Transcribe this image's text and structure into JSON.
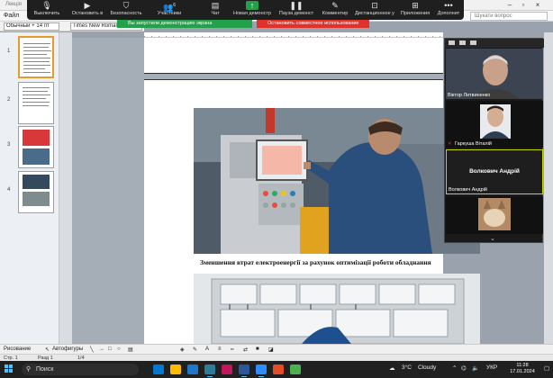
{
  "window": {
    "title": "Лекція"
  },
  "menu": {
    "file": "Файл",
    "search_placeholder": "Шукати вопрос"
  },
  "format": {
    "para_style": "Обычный + 14 пт",
    "font_name": "Times New Roman"
  },
  "zoom_toolbar": {
    "buttons": [
      {
        "name": "mute",
        "label": "Выключить",
        "icon": "◖"
      },
      {
        "name": "stop-video",
        "label": "Остановить в",
        "icon": "■"
      },
      {
        "name": "security",
        "label": "Безопасность",
        "icon": "⛉"
      },
      {
        "name": "participants",
        "label": "Участники",
        "icon": "👥"
      },
      {
        "name": "chat",
        "label": "Чат",
        "icon": "▤"
      },
      {
        "name": "new-share",
        "label": "Новая демонстр",
        "icon": "↑"
      },
      {
        "name": "pause-share",
        "label": "Пауза демонст",
        "icon": "❚❚"
      },
      {
        "name": "annotate",
        "label": "Комментир",
        "icon": "✎"
      },
      {
        "name": "remote-control",
        "label": "Дистанционное у",
        "icon": "⊡"
      },
      {
        "name": "apps",
        "label": "Приложения",
        "icon": "⊞"
      },
      {
        "name": "more",
        "label": "Дополнит",
        "icon": "•••"
      }
    ],
    "participant_count": "6",
    "share_banner": "Вы запустили демонстрацию экрана",
    "stop_banner": "Остановить совместное использование"
  },
  "document": {
    "caption": "Зменшення втрат електроенергії за рахунок оптимізації роботи обладнання"
  },
  "thumbnails": [
    {
      "num": "1",
      "active": true
    },
    {
      "num": "2",
      "active": false
    },
    {
      "num": "3",
      "active": false
    },
    {
      "num": "4",
      "active": false
    }
  ],
  "video": {
    "participants": [
      {
        "name": "Віктор Литвиненко",
        "has_video": true
      },
      {
        "name": "Гаркуша Віталій",
        "has_video": true
      },
      {
        "name": "Волкович Андрій",
        "has_video": false,
        "display": "Волкович Андрій"
      },
      {
        "name": "",
        "has_video": true
      }
    ]
  },
  "drawing_toolbar": {
    "draw": "Рисование",
    "autoshapes": "Автофигуры"
  },
  "status": {
    "page": "Стр. 1",
    "section": "Разд 1",
    "pages": "1/4"
  },
  "taskbar": {
    "search": "Поиск",
    "weather_temp": "3°C",
    "weather_text": "Cloudy",
    "lang": "УКР",
    "time": "11:28",
    "date": "17.01.2024"
  },
  "colors": {
    "zoom_green": "#23a14a",
    "zoom_red": "#e0322a",
    "taskbar": "#202020",
    "speaker_border": "#c7d400"
  }
}
